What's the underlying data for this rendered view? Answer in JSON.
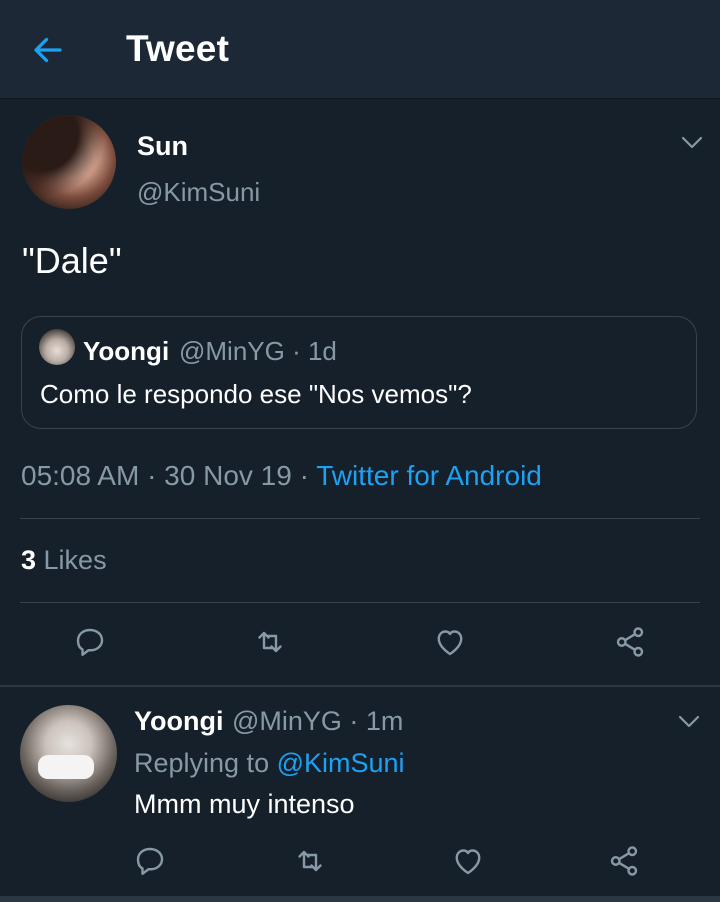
{
  "header": {
    "title": "Tweet",
    "back_icon": "arrow-left-icon"
  },
  "colors": {
    "background": "#15202b",
    "header_bg": "#1c2836",
    "accent": "#1da1f2",
    "secondary_text": "#8899a6",
    "border": "#38444d"
  },
  "tweet": {
    "author_name": "Sun",
    "author_handle": "@KimSuni",
    "text": "\"Dale\"",
    "timestamp": "05:08 AM · 30 Nov 19 · ",
    "source": "Twitter for Android",
    "likes_count": "3",
    "likes_label": " Likes",
    "quoted": {
      "author_name": "Yoongi",
      "author_handle": "@MinYG · 1d",
      "text": "Como le respondo ese \"Nos vemos\"?"
    },
    "actions": [
      "reply-icon",
      "retweet-icon",
      "like-icon",
      "share-icon"
    ]
  },
  "reply": {
    "author_name": "Yoongi",
    "author_handle": "@MinYG · 1m",
    "replying_prefix": "Replying to ",
    "replying_to": "@KimSuni",
    "text": "Mmm muy intenso",
    "actions": [
      "reply-icon",
      "retweet-icon",
      "like-icon",
      "share-icon"
    ]
  }
}
